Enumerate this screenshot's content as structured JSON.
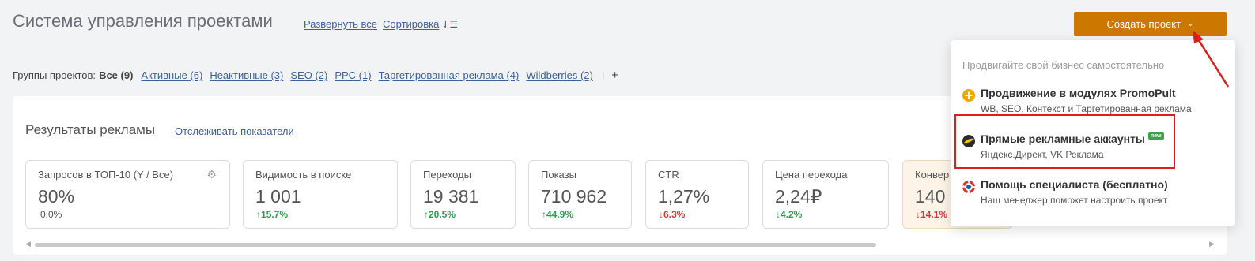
{
  "header": {
    "title": "Система управления проектами",
    "expand_all": "Развернуть все",
    "sort": "Сортировка",
    "create_button": "Создать проект"
  },
  "groups": {
    "label": "Группы проектов:",
    "all": "Все (9)",
    "items": [
      "Активные (6)",
      "Неактивные (3)",
      "SEO (2)",
      "PPC (1)",
      "Таргетированная реклама (4)",
      "Wildberries (2)"
    ],
    "separator": "|",
    "add": "+"
  },
  "results": {
    "title": "Результаты рекламы",
    "track_link": "Отслеживать показатели",
    "cards": [
      {
        "title": "Запросов в ТОП-10 (Y / Все)",
        "value": "80%",
        "delta": "0.0%",
        "trend": "neutral"
      },
      {
        "title": "Видимость в поиске",
        "value": "1 001",
        "delta": "↑15.7%",
        "trend": "up"
      },
      {
        "title": "Переходы",
        "value": "19 381",
        "delta": "↑20.5%",
        "trend": "up"
      },
      {
        "title": "Показы",
        "value": "710 962",
        "delta": "↑44.9%",
        "trend": "up"
      },
      {
        "title": "CTR",
        "value": "1,27%",
        "delta": "↓6.3%",
        "trend": "down"
      },
      {
        "title": "Цена перехода",
        "value": "2,24₽",
        "delta": "↓4.2%",
        "trend": "up"
      },
      {
        "title": "Конвер",
        "value": "140",
        "delta": "↓14.1%",
        "trend": "down"
      }
    ]
  },
  "dropdown": {
    "header": "Продвигайте свой бизнес самостоятельно",
    "items": [
      {
        "title": "Продвижение в модулях PromoPult",
        "subtitle": "WB, SEO, Контекст и Таргетированная реклама",
        "icon": "plus-circle-icon"
      },
      {
        "title": "Прямые рекламные аккаунты",
        "subtitle": "Яндекс.Директ, VK Реклама",
        "badge": "new",
        "icon": "yandex-ball-icon"
      },
      {
        "title": "Помощь специалиста (бесплатно)",
        "subtitle": "Наш менеджер поможет настроить проект",
        "icon": "lifebuoy-icon"
      }
    ]
  },
  "colors": {
    "accent": "#cc7700",
    "link": "#3e5f9c",
    "up": "#2e9d4f",
    "down": "#d23b3b",
    "highlight": "#e01d1d"
  }
}
